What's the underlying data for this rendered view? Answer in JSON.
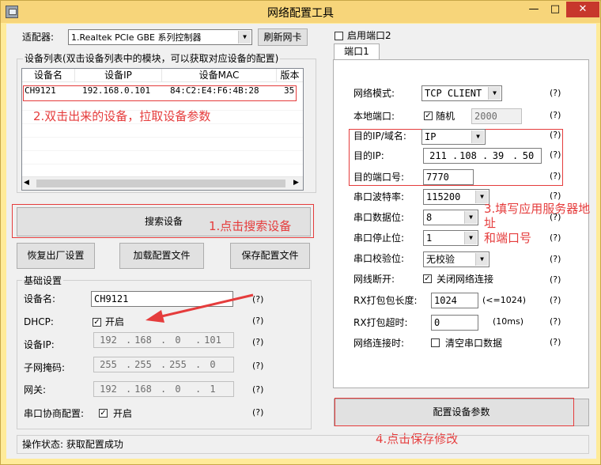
{
  "window": {
    "title": "网络配置工具",
    "minimize": "—",
    "maximize": "□",
    "close": "✕"
  },
  "adapter": {
    "label": "适配器:",
    "value": "1.Realtek PCIe GBE 系列控制器",
    "refresh": "刷新网卡"
  },
  "device_list": {
    "title": "设备列表(双击设备列表中的模块，可以获取对应设备的配置)",
    "columns": [
      "设备名",
      "设备IP",
      "设备MAC",
      "版本"
    ],
    "rows": [
      [
        "CH9121",
        "192.168.0.101",
        "84:C2:E4:F6:4B:28",
        "35"
      ]
    ]
  },
  "buttons": {
    "search": "搜索设备",
    "factory": "恢复出厂设置",
    "load": "加载配置文件",
    "save_file": "保存配置文件",
    "apply": "配置设备参数"
  },
  "basic": {
    "title": "基础设置",
    "name_label": "设备名:",
    "name": "CH9121",
    "dhcp_label": "DHCP:",
    "dhcp_text": "开启",
    "dhcp_checked": true,
    "ip_label": "设备IP:",
    "ip": [
      "192",
      "168",
      "0",
      "101"
    ],
    "mask_label": "子网掩码:",
    "mask": [
      "255",
      "255",
      "255",
      "0"
    ],
    "gw_label": "网关:",
    "gw": [
      "192",
      "168",
      "0",
      "1"
    ],
    "serial_label": "串口协商配置:",
    "serial_text": "开启",
    "serial_checked": true,
    "help": "(?)"
  },
  "port": {
    "enable2": "启用端口2",
    "tab": "端口1",
    "mode_label": "网络模式:",
    "mode": "TCP CLIENT",
    "local_label": "本地端口:",
    "random": "随机",
    "local_port": "2000",
    "dest_type_label": "目的IP/域名:",
    "dest_type": "IP",
    "dest_ip_label": "目的IP:",
    "dest_ip": [
      "211",
      "108",
      "39",
      "50"
    ],
    "dest_port_label": "目的端口号:",
    "dest_port": "7770",
    "baud_label": "串口波特率:",
    "baud": "115200",
    "data_label": "串口数据位:",
    "data_bits": "8",
    "stop_label": "串口停止位:",
    "stop_bits": "1",
    "parity_label": "串口校验位:",
    "parity": "无校验",
    "disc_label": "网线断开:",
    "disc_text": "关闭网络连接",
    "rxlen_label": "RX打包包长度:",
    "rxlen": "1024",
    "rxlen_hint": "(<=1024)",
    "rxto_label": "RX打包超时:",
    "rxto": "0",
    "rxto_unit": "(10ms)",
    "conn_label": "网络连接时:",
    "conn_text": "清空串口数据",
    "help": "(?)"
  },
  "status": {
    "text": "操作状态: 获取配置成功"
  },
  "annotations": {
    "a1": "1.点击搜索设备",
    "a2": "2.双击出来的设备，拉取设备参数",
    "a3_1": "3.填写应用服务器地",
    "a3_2": "址",
    "a3_3": "和端口号",
    "a4": "4.点击保存修改"
  },
  "colors": {
    "titlebar": "#f7d57a",
    "annotation": "#e53c3c",
    "close": "#c7372c"
  }
}
